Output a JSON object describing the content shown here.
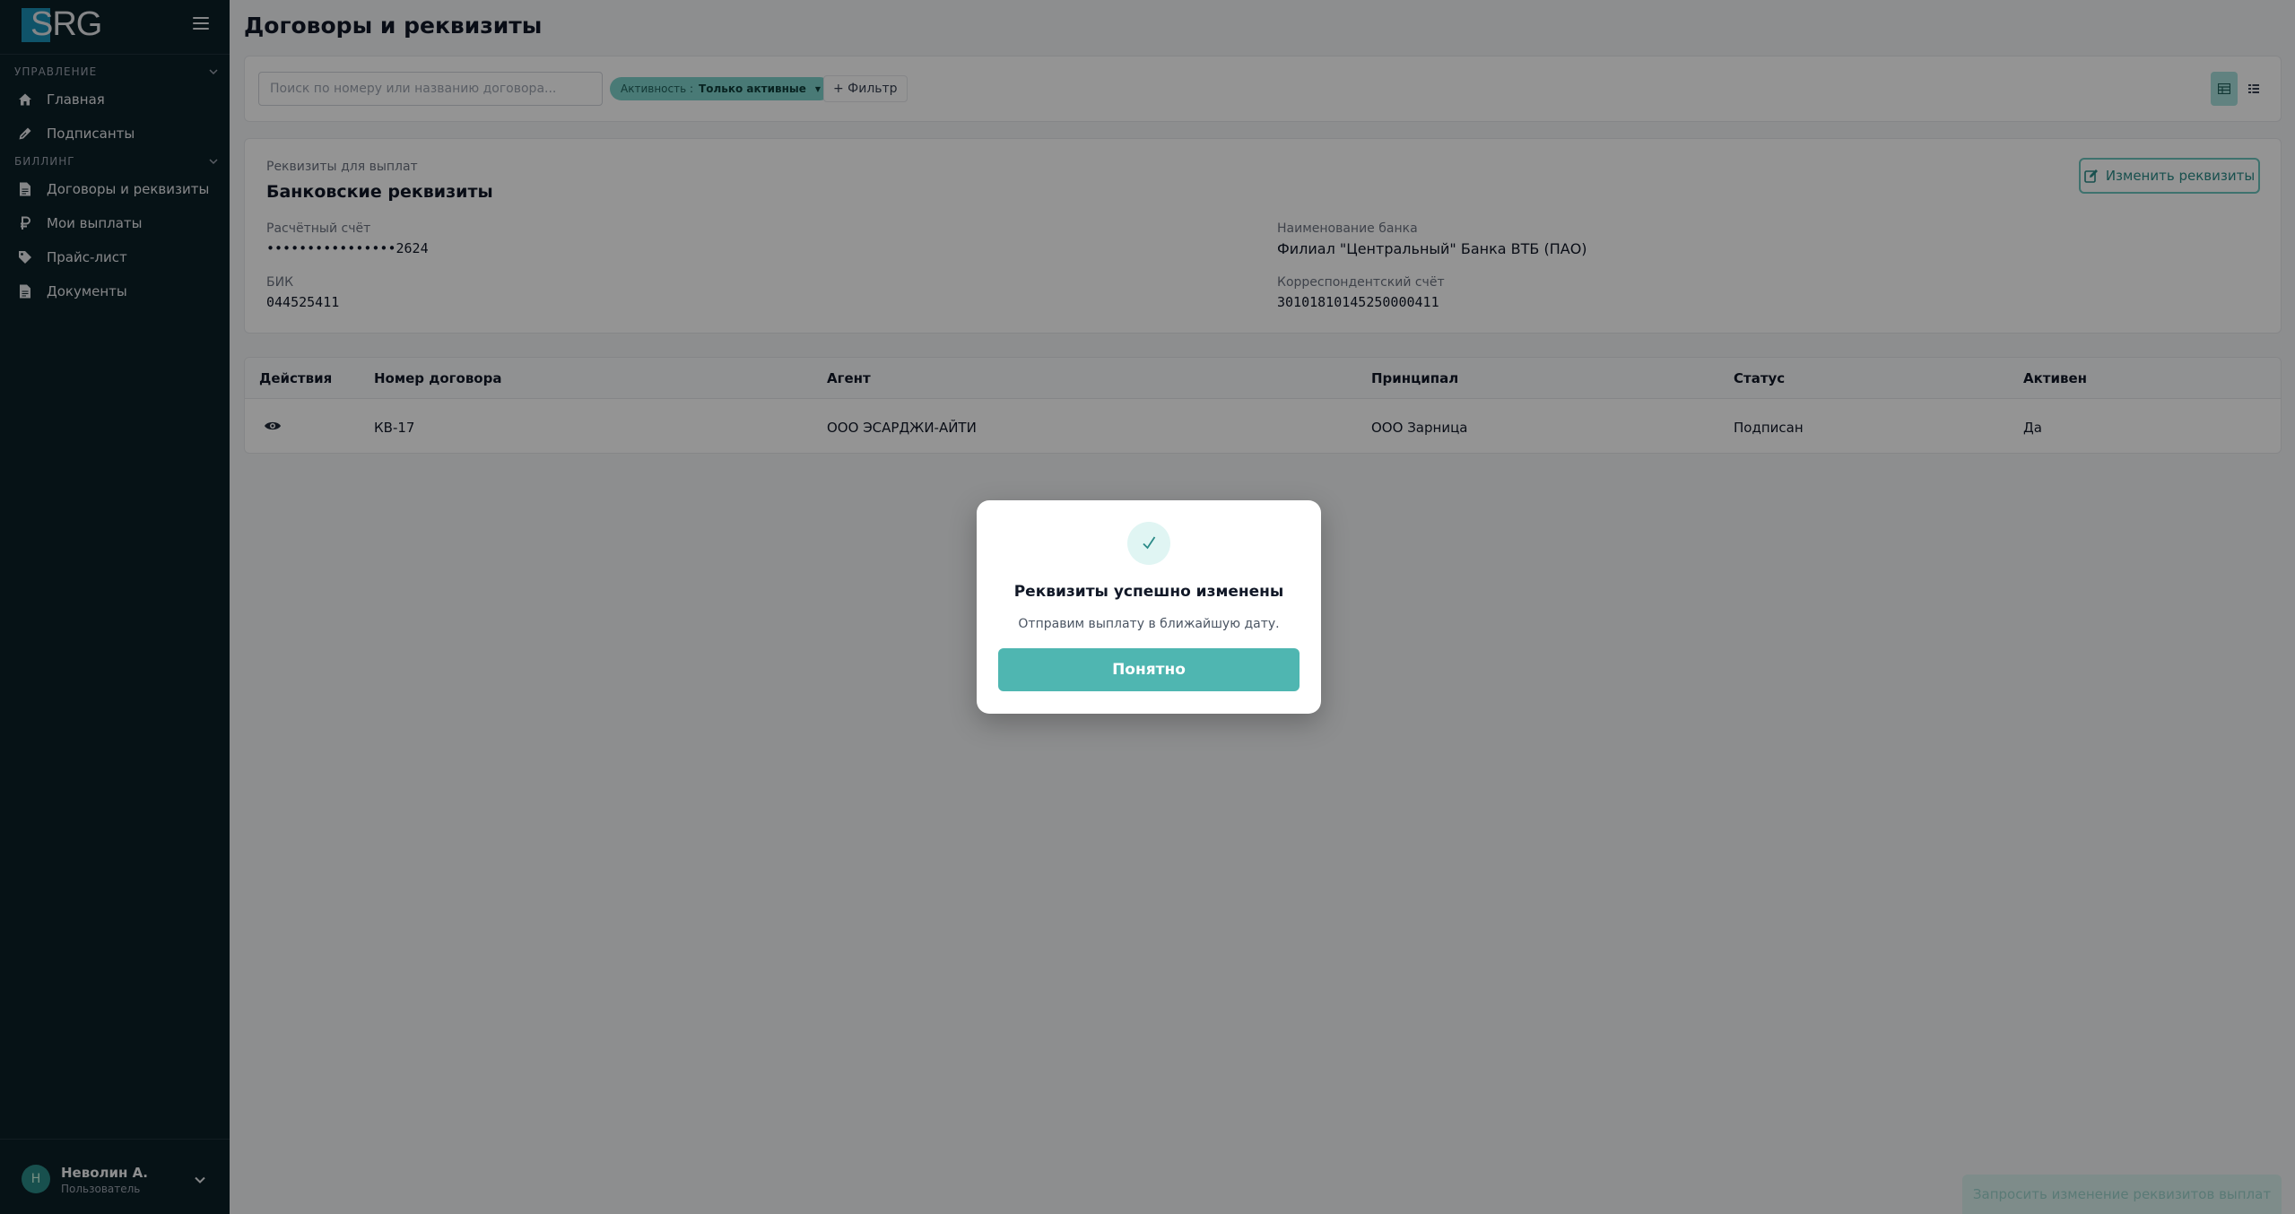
{
  "brand": {
    "logo_text": "SRG",
    "accent": "#4fb6b1",
    "sidebar_bg": "#0b1f26"
  },
  "sidebar": {
    "sections": [
      {
        "title": "УПРАВЛЕНИЕ"
      },
      {
        "title": "БИЛЛИНГ"
      }
    ],
    "items": [
      {
        "label": "Главная",
        "icon": "home-icon"
      },
      {
        "label": "Подписанты",
        "icon": "pen-icon"
      },
      {
        "label": "Договоры и реквизиты",
        "icon": "document-icon"
      },
      {
        "label": "Мои выплаты",
        "icon": "ruble-icon"
      },
      {
        "label": "Прайс-лист",
        "icon": "tag-icon"
      },
      {
        "label": "Документы",
        "icon": "document-icon"
      }
    ],
    "user": {
      "initial": "Н",
      "name": "Неволин А.",
      "role": "Пользователь"
    }
  },
  "header": {
    "title": "Договоры и реквизиты"
  },
  "filters": {
    "search_placeholder": "Поиск по номеру или названию договора...",
    "chip_key": "Активность :",
    "chip_value": "Только активные",
    "filter_label": "+ Фильтр"
  },
  "requisites": {
    "caption": "Реквизиты для выплат",
    "title": "Банковские реквизиты",
    "edit_label": "Изменить реквизиты",
    "account_label": "Расчётный счёт",
    "account_value": "••••••••••••••••2624",
    "bank_label": "Наименование банка",
    "bank_value": "Филиал \"Центральный\" Банка ВТБ (ПАО)",
    "bik_label": "БИК",
    "bik_value": "044525411",
    "corr_label": "Корреспондентский счёт",
    "corr_value": "30101810145250000411"
  },
  "table": {
    "columns": [
      "Действия",
      "Номер договора",
      "Агент",
      "Принципал",
      "Статус",
      "Активен"
    ],
    "rows": [
      {
        "number": "КВ-17",
        "agent": "ООО ЭСАРДЖИ-АЙТИ",
        "principal": "ООО Зарница",
        "status": "Подписан",
        "active": "Да"
      }
    ]
  },
  "footer": {
    "action_label": "Запросить изменение реквизитов выплат"
  },
  "modal": {
    "title": "Реквизиты успешно изменены",
    "text": "Отправим выплату в ближайшую дату.",
    "button": "Понятно"
  }
}
